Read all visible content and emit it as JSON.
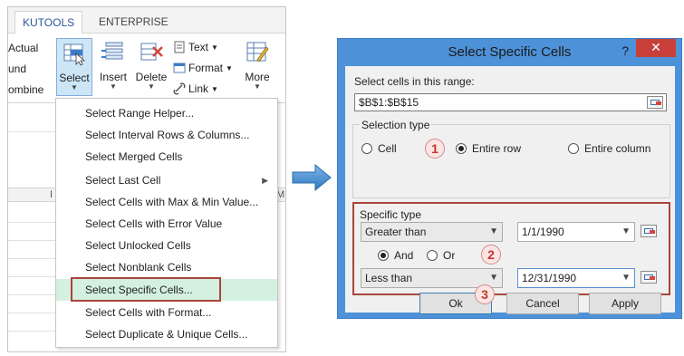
{
  "ribbon": {
    "tabs": [
      "KUTOOLS",
      "ENTERPRISE"
    ],
    "cut_labels": [
      "Actual",
      "und",
      "ombine"
    ],
    "buttons": {
      "select": "Select",
      "insert": "Insert",
      "delete": "Delete",
      "more": "More"
    },
    "small_buttons": [
      "Text",
      "Format",
      "Link"
    ],
    "col_header_fragments": [
      "I",
      "M"
    ]
  },
  "menu": {
    "items": [
      "Select Range Helper...",
      "Select Interval Rows & Columns...",
      "Select Merged Cells",
      "Select Last Cell",
      "Select Cells with Max & Min Value...",
      "Select Cells with Error Value",
      "Select Unlocked Cells",
      "Select Nonblank Cells",
      "Select Specific Cells...",
      "Select Cells with Format...",
      "Select Duplicate & Unique Cells..."
    ]
  },
  "dialog": {
    "title": "Select Specific Cells",
    "help": "?",
    "close": "✕",
    "range_label": "Select cells in this range:",
    "range_value": "$B$1:$B$15",
    "selection_type": {
      "legend": "Selection type",
      "options": [
        "Cell",
        "Entire row",
        "Entire column"
      ],
      "selected": "Entire row"
    },
    "specific_type": {
      "legend": "Specific type",
      "condition1": "Greater than",
      "value1": "1/1/1990",
      "logic_options": [
        "And",
        "Or"
      ],
      "logic_selected": "And",
      "condition2": "Less than",
      "value2": "12/31/1990"
    },
    "buttons": {
      "ok": "Ok",
      "cancel": "Cancel",
      "apply": "Apply"
    },
    "step_badges": [
      "1",
      "2",
      "3"
    ]
  },
  "colors": {
    "dialog_frame": "#4d92d8",
    "close_button": "#c9403a",
    "highlight_box": "#a8453b",
    "menu_highlight": "#d3f0e0",
    "ribbon_selected": "#cde6f7",
    "arrow": "#3a86c8"
  }
}
